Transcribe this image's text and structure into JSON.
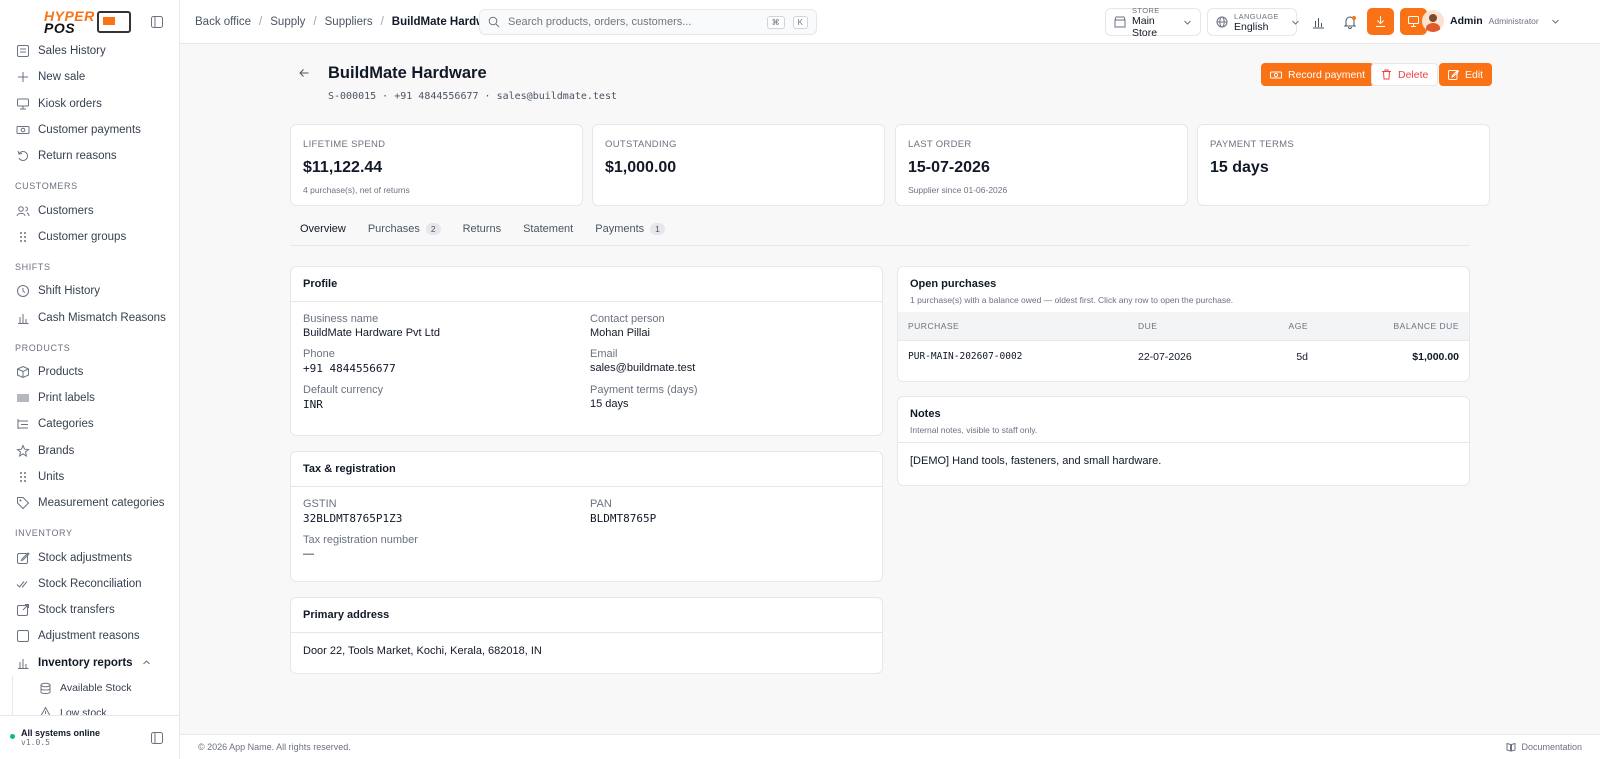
{
  "brand": {
    "logo_text_1": "HYPER",
    "logo_text_2": "POS"
  },
  "sidebar": {
    "items_top": [
      {
        "label": "Sales History",
        "icon": "list-icon"
      },
      {
        "label": "New sale",
        "icon": "plus-icon"
      },
      {
        "label": "Kiosk orders",
        "icon": "kiosk-icon"
      },
      {
        "label": "Customer payments",
        "icon": "cash-icon"
      },
      {
        "label": "Return reasons",
        "icon": "undo-icon"
      }
    ],
    "sections": {
      "customers": "CUSTOMERS",
      "shifts": "SHIFTS",
      "products": "PRODUCTS",
      "inventory": "INVENTORY"
    },
    "customers": [
      "Customers",
      "Customer groups"
    ],
    "shifts": [
      "Shift History",
      "Cash Mismatch Reasons"
    ],
    "products": [
      "Products",
      "Print labels",
      "Categories",
      "Brands",
      "Units",
      "Measurement categories"
    ],
    "inventory": [
      "Stock adjustments",
      "Stock Reconciliation",
      "Stock transfers",
      "Adjustment reasons",
      "Inventory reports"
    ],
    "inventory_sub": [
      "Available Stock",
      "Low stock"
    ],
    "status_title": "All systems online",
    "version": "v1.0.5"
  },
  "topbar": {
    "breadcrumbs": [
      "Back office",
      "Supply",
      "Suppliers",
      "BuildMate Hardware"
    ],
    "search_placeholder": "Search products, orders, customers...",
    "kbd_1": "⌘",
    "kbd_2": "K",
    "store_label": "STORE",
    "store_value": "Main Store",
    "language_label": "LANGUAGE",
    "language_value": "English",
    "user_name": "Admin",
    "user_role": "Administrator"
  },
  "header": {
    "title": "BuildMate Hardware",
    "subtitle": "S-000015 · +91 4844556677 · sales@buildmate.test",
    "record_payment": "Record payment",
    "delete": "Delete",
    "edit": "Edit"
  },
  "stats": [
    {
      "label": "LIFETIME SPEND",
      "value": "$11,122.44",
      "note": "4 purchase(s), net of returns"
    },
    {
      "label": "OUTSTANDING",
      "value": "$1,000.00",
      "note": ""
    },
    {
      "label": "LAST ORDER",
      "value": "15-07-2026",
      "note": "Supplier since 01-06-2026"
    },
    {
      "label": "PAYMENT TERMS",
      "value": "15 days",
      "note": ""
    }
  ],
  "tabs": [
    {
      "label": "Overview",
      "count": ""
    },
    {
      "label": "Purchases",
      "count": "2"
    },
    {
      "label": "Returns",
      "count": ""
    },
    {
      "label": "Statement",
      "count": ""
    },
    {
      "label": "Payments",
      "count": "1"
    }
  ],
  "profile": {
    "title": "Profile",
    "fields": [
      {
        "label": "Business name",
        "value": "BuildMate Hardware Pvt Ltd"
      },
      {
        "label": "Contact person",
        "value": "Mohan Pillai"
      },
      {
        "label": "Phone",
        "value": "+91 4844556677"
      },
      {
        "label": "Email",
        "value": "sales@buildmate.test"
      },
      {
        "label": "Default currency",
        "value": "INR"
      },
      {
        "label": "Payment terms (days)",
        "value": "15 days"
      }
    ]
  },
  "tax": {
    "title": "Tax & registration",
    "fields": [
      {
        "label": "GSTIN",
        "value": "32BLDMT8765P1Z3"
      },
      {
        "label": "PAN",
        "value": "BLDMT8765P"
      },
      {
        "label": "Tax registration number",
        "value": "—"
      }
    ]
  },
  "address": {
    "title": "Primary address",
    "value": "Door 22, Tools Market, Kochi, Kerala, 682018, IN"
  },
  "open_purchases": {
    "title": "Open purchases",
    "subtitle": "1 purchase(s) with a balance owed — oldest first. Click any row to open the purchase.",
    "columns": [
      "PURCHASE",
      "DUE",
      "AGE",
      "BALANCE DUE"
    ],
    "rows": [
      {
        "purchase": "PUR-MAIN-202607-0002",
        "due": "22-07-2026",
        "age": "5d",
        "balance": "$1,000.00"
      }
    ]
  },
  "notes": {
    "title": "Notes",
    "subtitle": "Internal notes, visible to staff only.",
    "body": "[DEMO] Hand tools, fasteners, and small hardware."
  },
  "footer": {
    "copyright": "© 2026 App Name. All rights reserved.",
    "documentation": "Documentation"
  },
  "colors": {
    "accent": "#f97316",
    "danger": "#ef4444",
    "online": "#10b981"
  }
}
